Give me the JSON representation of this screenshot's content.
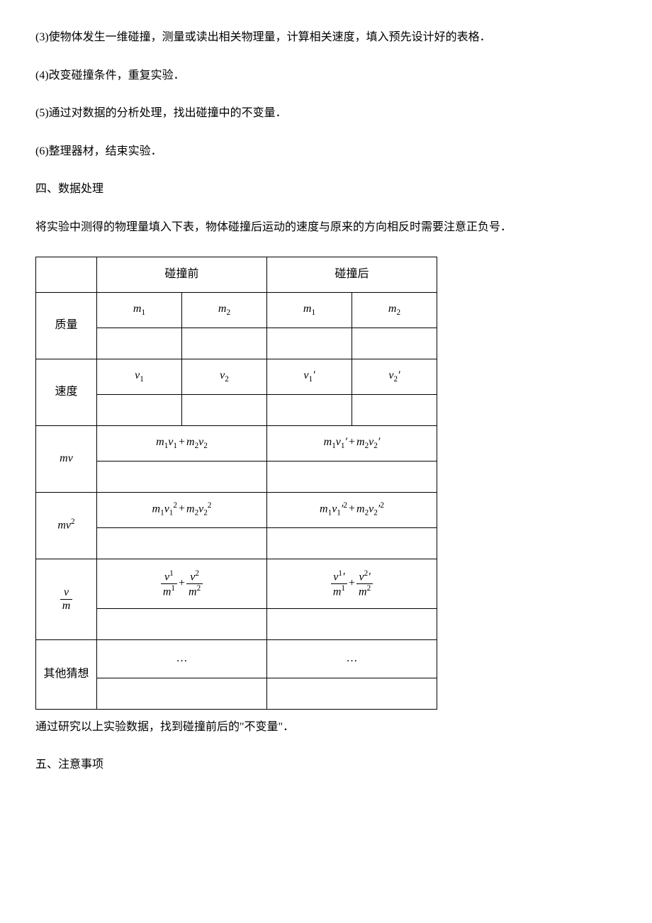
{
  "paragraphs": {
    "p3": "(3)使物体发生一维碰撞，测量或读出相关物理量，计算相关速度，填入预先设计好的表格．",
    "p4": "(4)改变碰撞条件，重复实验．",
    "p5": "(5)通过对数据的分析处理，找出碰撞中的不变量．",
    "p6": "(6)整理器材，结束实验．",
    "section4": "四、数据处理",
    "intro": "将实验中测得的物理量填入下表，物体碰撞后运动的速度与原来的方向相反时需要注意正负号．",
    "conclusion": "通过研究以上实验数据，找到碰撞前后的\"不变量\"．",
    "section5": "五、注意事项"
  },
  "table": {
    "header_before": "碰撞前",
    "header_after": "碰撞后",
    "row_mass": "质量",
    "row_velocity": "速度",
    "row_mv": "mv",
    "row_mv2_base": "mv",
    "row_vm_num": "v",
    "row_vm_den": "m",
    "row_other": "其他猜想",
    "m1": "m",
    "m2": "m",
    "v1": "v",
    "v2": "v",
    "ellipsis": "…"
  }
}
